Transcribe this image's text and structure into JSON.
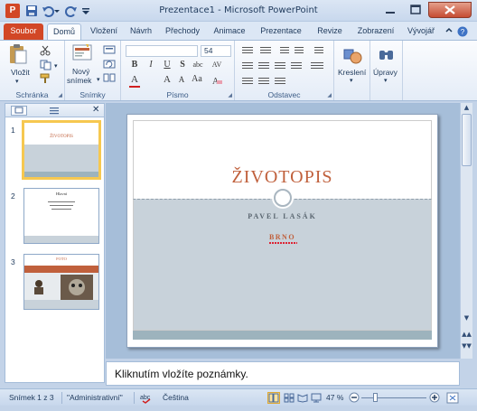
{
  "window": {
    "title": "Prezentace1 - Microsoft PowerPoint",
    "app_icon_letter": "P"
  },
  "tabs": [
    "Soubor",
    "Domů",
    "Vložení",
    "Návrh",
    "Přechody",
    "Animace",
    "Prezentace",
    "Revize",
    "Zobrazení",
    "Vývojář"
  ],
  "ribbon": {
    "clipboard": {
      "paste_label": "Vložit",
      "group_label": "Schránka"
    },
    "slides": {
      "new_slide_label_1": "Nový",
      "new_slide_label_2": "snímek",
      "group_label": "Snímky"
    },
    "font": {
      "size_value": "54",
      "group_label": "Písmo",
      "bold": "B",
      "italic": "I",
      "underline": "U",
      "strike": "S",
      "shadow": "abc",
      "spacing": "AV",
      "case": "Aa",
      "color": "A",
      "grow": "A",
      "shrink": "A"
    },
    "paragraph": {
      "group_label": "Odstavec"
    },
    "drawing": {
      "label": "Kreslení"
    },
    "editing": {
      "label": "Úpravy"
    }
  },
  "thumbnails": [
    {
      "num": "1",
      "title": "ŽIVOTOPIS"
    },
    {
      "num": "2",
      "title": "Hlavní"
    },
    {
      "num": "3",
      "title": "FOTO"
    }
  ],
  "slide": {
    "title": "ŽIVOTOPIS",
    "author": "PAVEL LASÁK",
    "city": "BRNO"
  },
  "notes": {
    "placeholder": "Kliknutím vložíte poznámky."
  },
  "status": {
    "slide_info": "Snímek 1 z 3",
    "theme": "\"Administrativní\"",
    "language": "Čeština",
    "zoom": "47 %"
  },
  "colors": {
    "accent": "#c0603c",
    "file_tab": "#d24726"
  }
}
